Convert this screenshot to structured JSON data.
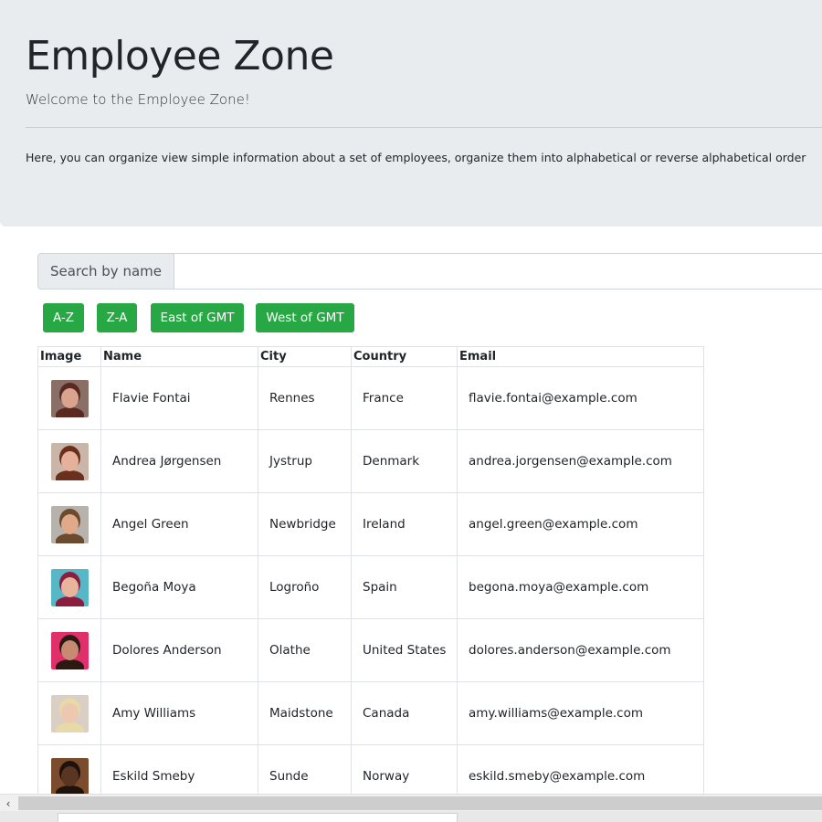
{
  "header": {
    "title": "Employee Zone",
    "subtitle": "Welcome to the Employee Zone!",
    "description": "Here, you can organize view simple information about a set of employees, organize them into alphabetical or reverse alphabetical order"
  },
  "search": {
    "label": "Search by name",
    "value": "",
    "placeholder": ""
  },
  "buttons": {
    "az": "A-Z",
    "za": "Z-A",
    "east": "East of GMT",
    "west": "West of GMT"
  },
  "table": {
    "headers": [
      "Image",
      "Name",
      "City",
      "Country",
      "Email"
    ],
    "rows": [
      {
        "name": "Flavie Fontai",
        "city": "Rennes",
        "country": "France",
        "email": "flavie.fontai@example.com",
        "avatar": {
          "bg": "#8a6f66",
          "skin": "#d9a48e",
          "hair": "#5a2a22"
        }
      },
      {
        "name": "Andrea Jørgensen",
        "city": "Jystrup",
        "country": "Denmark",
        "email": "andrea.jorgensen@example.com",
        "avatar": {
          "bg": "#c9b6a8",
          "skin": "#e6b19a",
          "hair": "#6b2f1e"
        }
      },
      {
        "name": "Angel Green",
        "city": "Newbridge",
        "country": "Ireland",
        "email": "angel.green@example.com",
        "avatar": {
          "bg": "#b7b2ab",
          "skin": "#e0a98a",
          "hair": "#6b4a2e"
        }
      },
      {
        "name": "Begoña Moya",
        "city": "Logroño",
        "country": "Spain",
        "email": "begona.moya@example.com",
        "avatar": {
          "bg": "#57b7c4",
          "skin": "#e8b59c",
          "hair": "#8b1e3f"
        }
      },
      {
        "name": "Dolores Anderson",
        "city": "Olathe",
        "country": "United States",
        "email": "dolores.anderson@example.com",
        "avatar": {
          "bg": "#e0306a",
          "skin": "#c98a72",
          "hair": "#2b1a14"
        }
      },
      {
        "name": "Amy Williams",
        "city": "Maidstone",
        "country": "Canada",
        "email": "amy.williams@example.com",
        "avatar": {
          "bg": "#d9cfc4",
          "skin": "#edc8b0",
          "hair": "#e7d9a8"
        }
      },
      {
        "name": "Eskild Smeby",
        "city": "Sunde",
        "country": "Norway",
        "email": "eskild.smeby@example.com",
        "avatar": {
          "bg": "#7a4b2c",
          "skin": "#5a3522",
          "hair": "#1e120c"
        }
      }
    ]
  },
  "scrollbar": {
    "left_arrow": "‹"
  }
}
